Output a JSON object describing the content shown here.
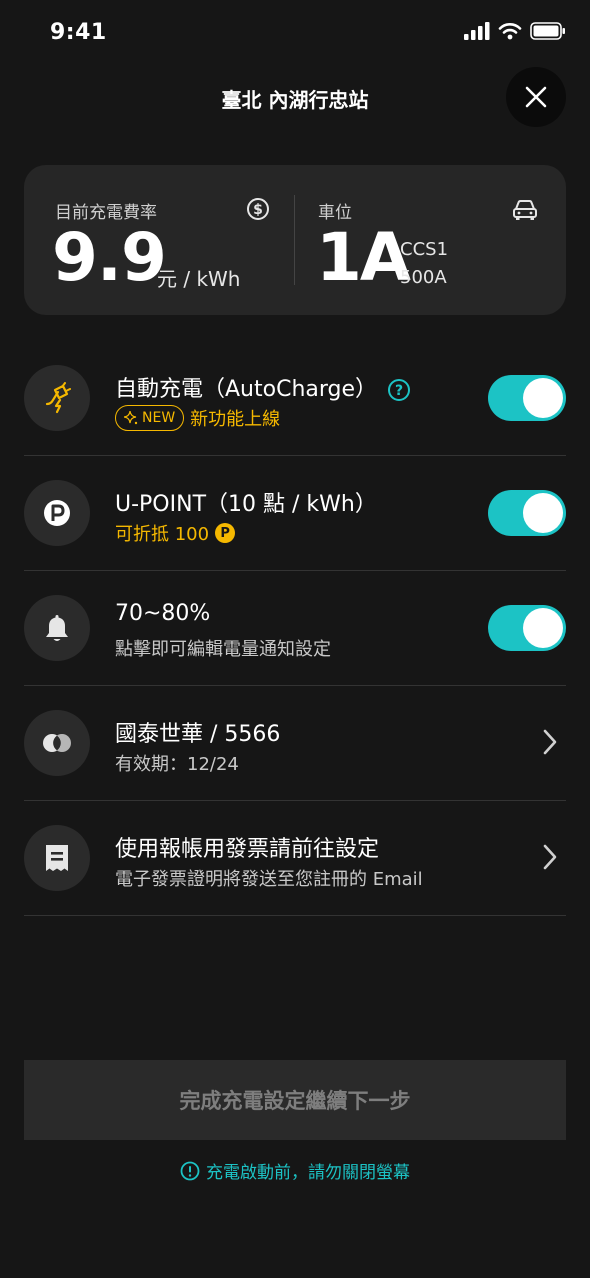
{
  "status_bar": {
    "time": "9:41"
  },
  "header": {
    "title": "臺北 內湖行忠站"
  },
  "info_card": {
    "rate_label": "目前充電費率",
    "rate_value": "9.9",
    "rate_unit": "元 / kWh",
    "bay_label": "車位",
    "bay_value": "1A",
    "connector": "CCS1",
    "power": "500A"
  },
  "rows": {
    "autocharge": {
      "title": "自動充電（AutoCharge）",
      "badge": "NEW",
      "subtitle": "新功能上線",
      "enabled": true
    },
    "upoint": {
      "title": "U-POINT（10 點 / kWh）",
      "subtitle": "可折抵 100",
      "coin_label": "P",
      "enabled": true
    },
    "notify": {
      "title": "70~80%",
      "subtitle": "點擊即可編輯電量通知設定",
      "enabled": true
    },
    "card": {
      "title": "國泰世華 / 5566",
      "subtitle": "有效期：12/24"
    },
    "invoice": {
      "title": "使用報帳用發票請前往設定",
      "subtitle": "電子發票證明將發送至您註冊的 Email"
    }
  },
  "next_button": {
    "label": "完成充電設定繼續下一步"
  },
  "warning": {
    "text": "充電啟動前，請勿關閉螢幕"
  },
  "colors": {
    "accent": "#1cc3c5",
    "highlight": "#f5b800",
    "background": "#161616",
    "card": "#262626"
  }
}
